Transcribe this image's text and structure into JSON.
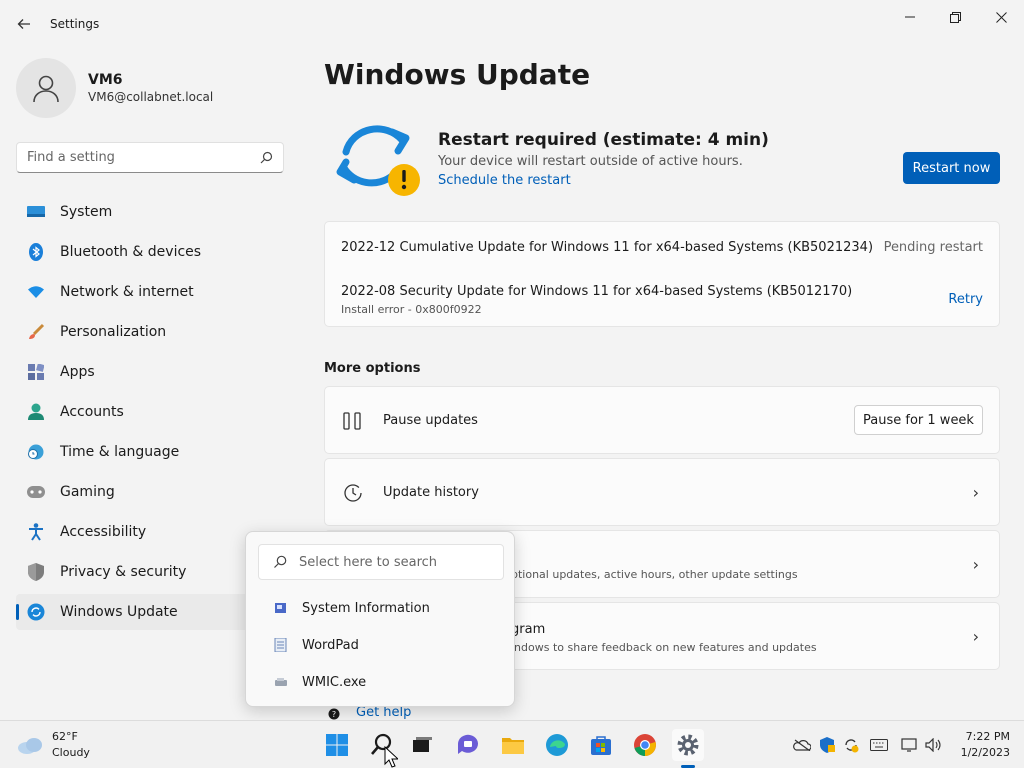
{
  "window": {
    "title": "Settings"
  },
  "profile": {
    "name": "VM6",
    "email": "VM6@collabnet.local"
  },
  "search": {
    "placeholder": "Find a setting"
  },
  "nav": [
    {
      "label": "System",
      "icon": "monitor-icon"
    },
    {
      "label": "Bluetooth & devices",
      "icon": "bluetooth-icon"
    },
    {
      "label": "Network & internet",
      "icon": "wifi-icon"
    },
    {
      "label": "Personalization",
      "icon": "brush-icon"
    },
    {
      "label": "Apps",
      "icon": "apps-icon"
    },
    {
      "label": "Accounts",
      "icon": "person-icon"
    },
    {
      "label": "Time & language",
      "icon": "globe-clock-icon"
    },
    {
      "label": "Gaming",
      "icon": "gamepad-icon"
    },
    {
      "label": "Accessibility",
      "icon": "accessibility-icon"
    },
    {
      "label": "Privacy & security",
      "icon": "shield-icon"
    },
    {
      "label": "Windows Update",
      "icon": "update-icon",
      "active": true
    }
  ],
  "main": {
    "title": "Windows Update",
    "status": {
      "title": "Restart required (estimate: 4 min)",
      "subtitle": "Your device will restart outside of active hours.",
      "link": "Schedule the restart",
      "button": "Restart now"
    },
    "updates": [
      {
        "name": "2022-12 Cumulative Update for Windows 11 for x64-based Systems (KB5021234)",
        "status": "Pending restart"
      },
      {
        "name": "2022-08 Security Update for Windows 11 for x64-based Systems (KB5012170)",
        "detail": "Install error - 0x800f0922",
        "action": "Retry"
      }
    ],
    "more_options_label": "More options",
    "options": [
      {
        "title": "Pause updates",
        "button": "Pause for 1 week"
      },
      {
        "title": "Update history"
      },
      {
        "title": "",
        "subtitle": "ptional updates, active hours, other update settings"
      },
      {
        "title": "gram",
        "subtitle": "indows to share feedback on new features and updates"
      }
    ],
    "get_help": "Get help"
  },
  "flyout": {
    "placeholder": "Select here to search",
    "items": [
      "System Information",
      "WordPad",
      "WMIC.exe"
    ]
  },
  "taskbar": {
    "weather": {
      "temp": "62°F",
      "condition": "Cloudy"
    },
    "clock": {
      "time": "7:22 PM",
      "date": "1/2/2023"
    }
  },
  "colors": {
    "accent": "#005fb8"
  }
}
